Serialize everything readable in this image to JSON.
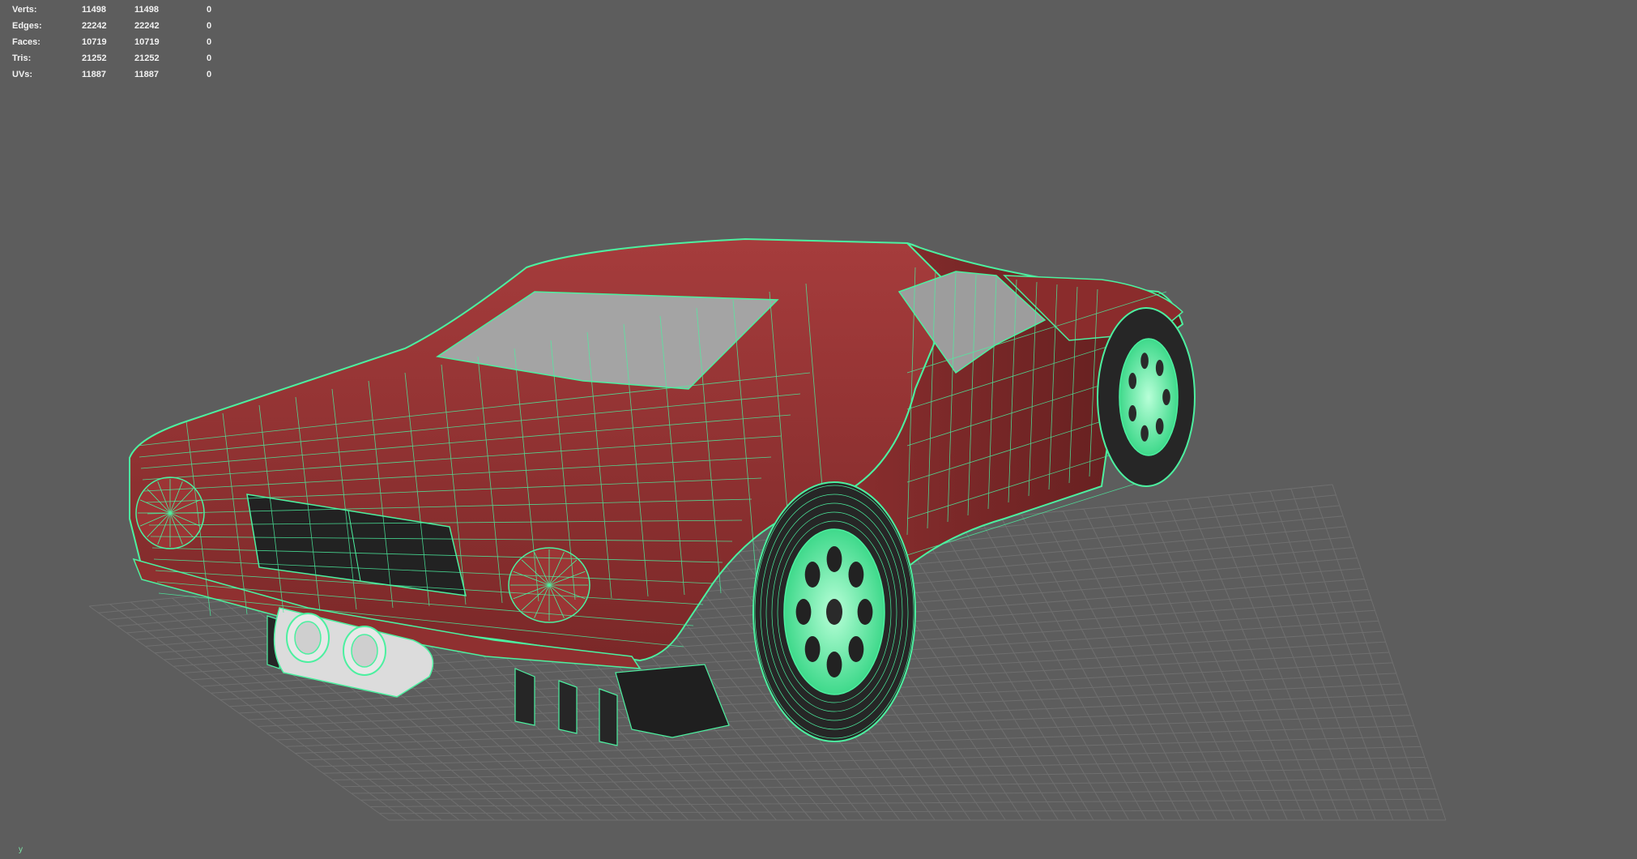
{
  "hud": {
    "rows": [
      {
        "label": "Verts:",
        "v1": "11498",
        "v2": "11498",
        "v3": "0"
      },
      {
        "label": "Edges:",
        "v1": "22242",
        "v2": "22242",
        "v3": "0"
      },
      {
        "label": "Faces:",
        "v1": "10719",
        "v2": "10719",
        "v3": "0"
      },
      {
        "label": "Tris:",
        "v1": "21252",
        "v2": "21252",
        "v3": "0"
      },
      {
        "label": "UVs:",
        "v1": "11887",
        "v2": "11887",
        "v3": "0"
      }
    ]
  },
  "axis": {
    "label": "y"
  },
  "colors": {
    "background": "#5d5d5d",
    "grid": "#6e6e6e",
    "body": "#9c3535",
    "body_shadow": "#6e2424",
    "wire": "#4cf0a0",
    "glass": "#a9a9a9",
    "wheel": "#7ef0b8",
    "tire": "#2a2a2a",
    "exhaust": "#dcdcdc"
  }
}
